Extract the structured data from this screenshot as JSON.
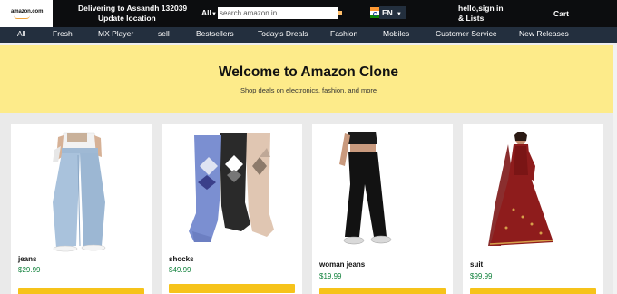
{
  "header": {
    "logo_text": "amazon.com",
    "deliver_line1": "Delivering to Assandh 132039",
    "deliver_line2": "Update location",
    "search_category": "All",
    "search_placeholder": "search amazon.in",
    "language": "EN",
    "account_line1": "hello,sign in",
    "account_line2": "& Lists",
    "cart_label": "Cart"
  },
  "nav": {
    "items": [
      "All",
      "Fresh",
      "MX Player",
      "sell",
      "Bestsellers",
      "Today's Dreals",
      "Fashion",
      "Mobiles",
      "Customer Service",
      "New Releases"
    ]
  },
  "hero": {
    "title": "Welcome to Amazon Clone",
    "subtitle": "Shop deals on electronics, fashion, and more"
  },
  "products": [
    {
      "name": "jeans",
      "price": "$29.99",
      "icon": "jeans-image"
    },
    {
      "name": "shocks",
      "price": "$49.99",
      "icon": "socks-image"
    },
    {
      "name": "woman jeans",
      "price": "$19.99",
      "icon": "woman-jeans-image"
    },
    {
      "name": "suit",
      "price": "$99.99",
      "icon": "suit-image"
    }
  ],
  "colors": {
    "header_bg": "#0c0d0f",
    "nav_bg": "#232f3e",
    "hero_bg": "#fdeb8a",
    "price": "#12823d",
    "button": "#f6c31a"
  }
}
